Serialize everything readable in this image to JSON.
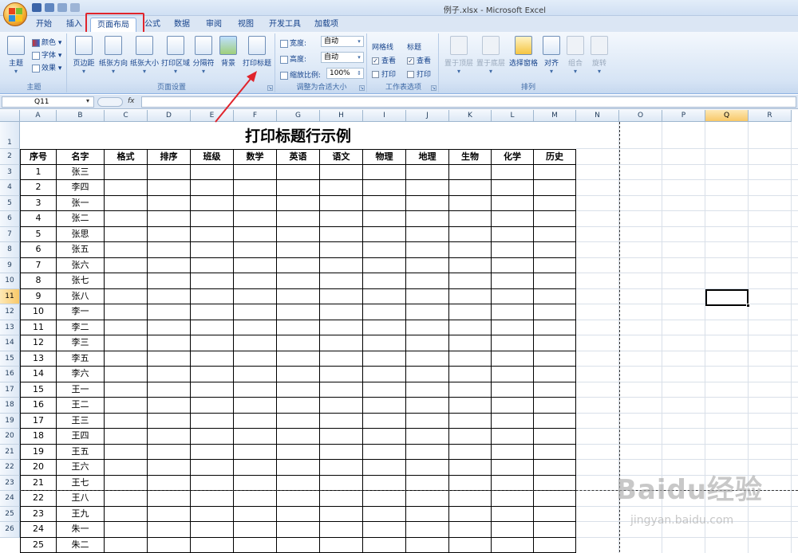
{
  "window": {
    "title": "例子.xlsx - Microsoft Excel"
  },
  "tabs": [
    "开始",
    "插入",
    "页面布局",
    "公式",
    "数据",
    "审阅",
    "视图",
    "开发工具",
    "加载项"
  ],
  "active_tab": "页面布局",
  "ribbon": {
    "themes": {
      "title": "主题",
      "big": "主题",
      "colors": "颜色",
      "fonts": "字体",
      "effects": "效果"
    },
    "page_setup": {
      "title": "页面设置",
      "margins": "页边距",
      "orientation": "纸张方向",
      "size": "纸张大小",
      "print_area": "打印区域",
      "breaks": "分隔符",
      "background": "背景",
      "print_titles": "打印标题"
    },
    "scale": {
      "title": "调整为合适大小",
      "width_label": "宽度:",
      "width_value": "自动",
      "height_label": "高度:",
      "height_value": "自动",
      "scale_label": "缩放比例:",
      "scale_value": "100%"
    },
    "sheet_options": {
      "title": "工作表选项",
      "gridlines": "网格线",
      "headings": "标题",
      "view": "查看",
      "print": "打印"
    },
    "arrange": {
      "title": "排列",
      "bring_front": "置于顶层",
      "send_back": "置于底层",
      "selection_pane": "选择窗格",
      "align": "对齐",
      "group": "组合",
      "rotate": "旋转"
    }
  },
  "formula_bar": {
    "name_box": "Q11",
    "fx": "fx",
    "formula": ""
  },
  "columns": [
    "A",
    "B",
    "C",
    "D",
    "E",
    "F",
    "G",
    "H",
    "I",
    "J",
    "K",
    "L",
    "M",
    "N",
    "O",
    "P",
    "Q",
    "R"
  ],
  "selected_column": "Q",
  "selected_row": "11",
  "sheet": {
    "title": "打印标题行示例",
    "headers": [
      "序号",
      "名字",
      "格式",
      "排序",
      "班级",
      "数学",
      "英语",
      "语文",
      "物理",
      "地理",
      "生物",
      "化学",
      "历史"
    ],
    "rows": [
      [
        "1",
        "张三"
      ],
      [
        "2",
        "李四"
      ],
      [
        "3",
        "张一"
      ],
      [
        "4",
        "张二"
      ],
      [
        "5",
        "张思"
      ],
      [
        "6",
        "张五"
      ],
      [
        "7",
        "张六"
      ],
      [
        "8",
        "张七"
      ],
      [
        "9",
        "张八"
      ],
      [
        "10",
        "李一"
      ],
      [
        "11",
        "李二"
      ],
      [
        "12",
        "李三"
      ],
      [
        "13",
        "李五"
      ],
      [
        "14",
        "李六"
      ],
      [
        "15",
        "王一"
      ],
      [
        "16",
        "王二"
      ],
      [
        "17",
        "王三"
      ],
      [
        "18",
        "王四"
      ],
      [
        "19",
        "王五"
      ],
      [
        "20",
        "王六"
      ],
      [
        "21",
        "王七"
      ],
      [
        "22",
        "王八"
      ],
      [
        "23",
        "王九"
      ],
      [
        "24",
        "朱一"
      ],
      [
        "25",
        "朱二"
      ]
    ]
  },
  "row_numbers": [
    "1",
    "2",
    "3",
    "4",
    "5",
    "6",
    "7",
    "8",
    "9",
    "10",
    "11",
    "12",
    "13",
    "14",
    "15",
    "16",
    "17",
    "18",
    "19",
    "20",
    "21",
    "22",
    "23",
    "24",
    "25",
    "26"
  ],
  "watermark": {
    "brand": "Baidu经验",
    "url": "jingyan.baidu.com"
  },
  "colors": {
    "highlight": "#e0242c",
    "selected_header": "#f8c868"
  }
}
